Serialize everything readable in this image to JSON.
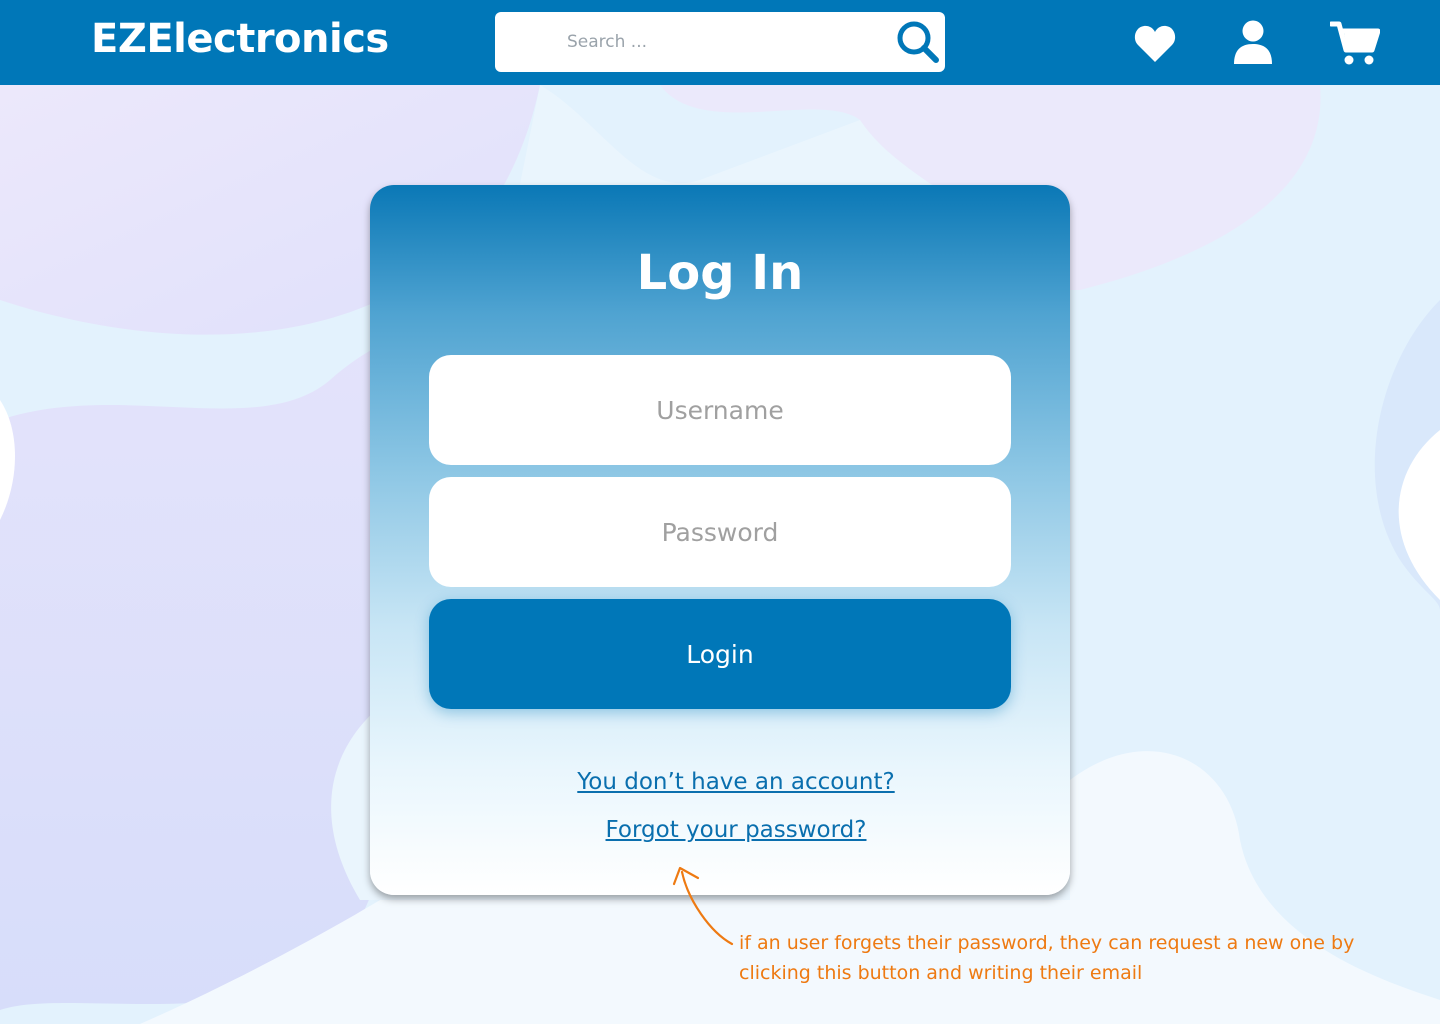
{
  "header": {
    "logo": "EZElectronics",
    "search_placeholder": "Search ...",
    "icons": [
      "search-icon",
      "heart-icon",
      "user-icon",
      "cart-icon"
    ]
  },
  "login_card": {
    "title": "Log In",
    "username_placeholder": "Username",
    "password_placeholder": "Password",
    "login_label": "Login",
    "signup_link": "You don’t have an account?",
    "forgot_link": "Forgot your password?"
  },
  "annotation": {
    "text": "if an user forgets their password, they can request a new one by clicking this button and writing their email"
  },
  "colors": {
    "header": "#0077b8",
    "button": "#0077b8",
    "link": "#0a6fae",
    "annotation": "#ee7a12"
  }
}
